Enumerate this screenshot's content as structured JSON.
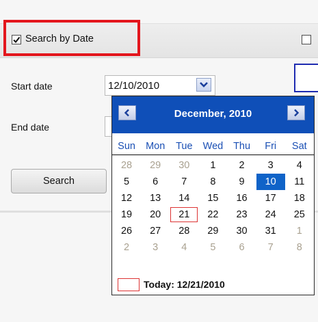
{
  "filter": {
    "search_by_date_label": "Search by Date",
    "search_by_date_checked": true,
    "right_checkbox_checked": false
  },
  "form": {
    "start_date_label": "Start date",
    "start_date_value": "12/10/2010",
    "end_date_label": "End date",
    "search_label": "Search"
  },
  "calendar": {
    "title": "December, 2010",
    "weekdays": [
      "Sun",
      "Mon",
      "Tue",
      "Wed",
      "Thu",
      "Fri",
      "Sat"
    ],
    "weeks": [
      [
        {
          "d": "28",
          "o": true
        },
        {
          "d": "29",
          "o": true
        },
        {
          "d": "30",
          "o": true
        },
        {
          "d": "1"
        },
        {
          "d": "2"
        },
        {
          "d": "3"
        },
        {
          "d": "4"
        }
      ],
      [
        {
          "d": "5"
        },
        {
          "d": "6"
        },
        {
          "d": "7"
        },
        {
          "d": "8"
        },
        {
          "d": "9"
        },
        {
          "d": "10",
          "sel": true
        },
        {
          "d": "11"
        }
      ],
      [
        {
          "d": "12"
        },
        {
          "d": "13"
        },
        {
          "d": "14"
        },
        {
          "d": "15"
        },
        {
          "d": "16"
        },
        {
          "d": "17"
        },
        {
          "d": "18"
        }
      ],
      [
        {
          "d": "19"
        },
        {
          "d": "20"
        },
        {
          "d": "21",
          "today": true
        },
        {
          "d": "22"
        },
        {
          "d": "23"
        },
        {
          "d": "24"
        },
        {
          "d": "25"
        }
      ],
      [
        {
          "d": "26"
        },
        {
          "d": "27"
        },
        {
          "d": "28"
        },
        {
          "d": "29"
        },
        {
          "d": "30"
        },
        {
          "d": "31"
        },
        {
          "d": "1",
          "o": true
        }
      ],
      [
        {
          "d": "2",
          "o": true
        },
        {
          "d": "3",
          "o": true
        },
        {
          "d": "4",
          "o": true
        },
        {
          "d": "5",
          "o": true
        },
        {
          "d": "6",
          "o": true
        },
        {
          "d": "7",
          "o": true
        },
        {
          "d": "8",
          "o": true
        }
      ]
    ],
    "today_text": "Today: 12/21/2010"
  },
  "colors": {
    "highlight": "#e3161d",
    "calendar_header": "#0f4fb8",
    "selected_day": "#0f63c8",
    "today_outline": "#dd3333",
    "weekday_text": "#1a4fb4"
  },
  "icons": {
    "prev": "chevron-left-icon",
    "next": "chevron-right-icon",
    "dropdown": "chevron-down-icon",
    "check": "check-icon"
  }
}
